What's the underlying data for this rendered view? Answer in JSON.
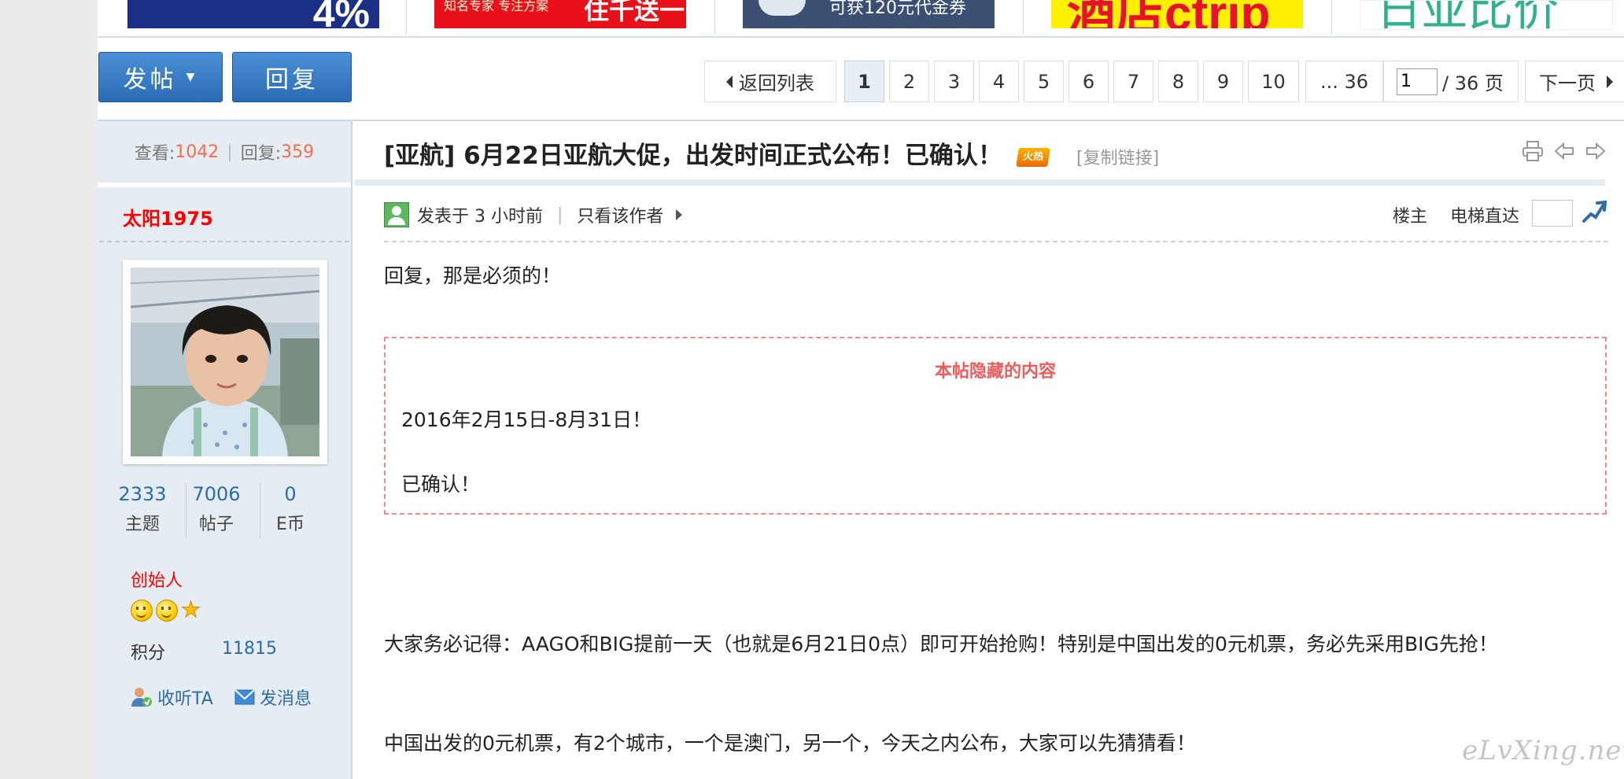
{
  "ads": {
    "ad1_text": "4%",
    "ad2_small": "知名专家 专注方案",
    "ad2_big": "住千送一",
    "ad3_text": "可获120元代金券",
    "ad4_text": "酒店ctrip",
    "ad5_text": "日亚比价"
  },
  "toolbar": {
    "post_label": "发帖",
    "reply_label": "回复"
  },
  "pager": {
    "back_label": "返回列表",
    "pages": [
      "1",
      "2",
      "3",
      "4",
      "5",
      "6",
      "7",
      "8",
      "9",
      "10"
    ],
    "last_label": "... 36",
    "current_value": "1",
    "total_label": "/ 36 页",
    "next_label": "下一页"
  },
  "thread_stats": {
    "views_label": "查看:",
    "views": "1042",
    "replies_label": "回复:",
    "replies": "359"
  },
  "author": {
    "name": "太阳1975",
    "topics": "2333",
    "topics_label": "主题",
    "posts": "7006",
    "posts_label": "帖子",
    "ecoin": "0",
    "ecoin_label": "E币",
    "rank": "创始人",
    "score_label": "积分",
    "score": "11815",
    "follow_label": "收听TA",
    "message_label": "发消息"
  },
  "post": {
    "title": "[亚航] 6月22日亚航大促，出发时间正式公布！已确认！",
    "hot_badge": "火热",
    "copy_link": "[复制链接]",
    "posted_at": "发表于 3 小时前",
    "only_author": "只看该作者",
    "floor_label": "楼主",
    "elevator_label": "电梯直达",
    "reply_line": "回复，那是必须的！",
    "hidden_title": "本帖隐藏的内容",
    "hidden_line1": "2016年2月15日-8月31日！",
    "hidden_line2": "已确认！",
    "para1": "大家务必记得：AAGO和BIG提前一天（也就是6月21日0点）即可开始抢购！特别是中国出发的0元机票，务必先采用BIG先抢！",
    "para2": "中国出发的0元机票，有2个城市，一个是澳门，另一个，今天之内公布，大家可以先猜猜看！"
  },
  "watermark": "eLvXing.net",
  "colors": {
    "accent_blue": "#2e6bab",
    "button_blue": "#2a6cb6",
    "stat_orange": "#f26c4f",
    "author_red": "#ff0000",
    "hidden_border": "#f08a8a",
    "sidebar_bg": "#e5edf2"
  }
}
